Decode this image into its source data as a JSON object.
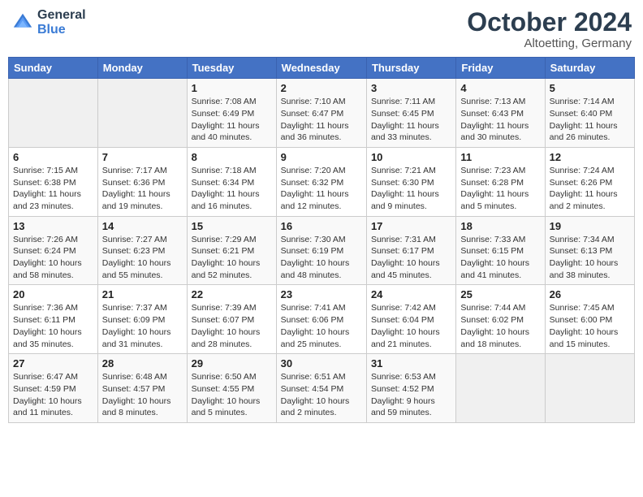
{
  "header": {
    "logo_line1": "General",
    "logo_line2": "Blue",
    "month": "October 2024",
    "location": "Altoetting, Germany"
  },
  "weekdays": [
    "Sunday",
    "Monday",
    "Tuesday",
    "Wednesday",
    "Thursday",
    "Friday",
    "Saturday"
  ],
  "weeks": [
    [
      {
        "day": "",
        "info": ""
      },
      {
        "day": "",
        "info": ""
      },
      {
        "day": "1",
        "info": "Sunrise: 7:08 AM\nSunset: 6:49 PM\nDaylight: 11 hours\nand 40 minutes."
      },
      {
        "day": "2",
        "info": "Sunrise: 7:10 AM\nSunset: 6:47 PM\nDaylight: 11 hours\nand 36 minutes."
      },
      {
        "day": "3",
        "info": "Sunrise: 7:11 AM\nSunset: 6:45 PM\nDaylight: 11 hours\nand 33 minutes."
      },
      {
        "day": "4",
        "info": "Sunrise: 7:13 AM\nSunset: 6:43 PM\nDaylight: 11 hours\nand 30 minutes."
      },
      {
        "day": "5",
        "info": "Sunrise: 7:14 AM\nSunset: 6:40 PM\nDaylight: 11 hours\nand 26 minutes."
      }
    ],
    [
      {
        "day": "6",
        "info": "Sunrise: 7:15 AM\nSunset: 6:38 PM\nDaylight: 11 hours\nand 23 minutes."
      },
      {
        "day": "7",
        "info": "Sunrise: 7:17 AM\nSunset: 6:36 PM\nDaylight: 11 hours\nand 19 minutes."
      },
      {
        "day": "8",
        "info": "Sunrise: 7:18 AM\nSunset: 6:34 PM\nDaylight: 11 hours\nand 16 minutes."
      },
      {
        "day": "9",
        "info": "Sunrise: 7:20 AM\nSunset: 6:32 PM\nDaylight: 11 hours\nand 12 minutes."
      },
      {
        "day": "10",
        "info": "Sunrise: 7:21 AM\nSunset: 6:30 PM\nDaylight: 11 hours\nand 9 minutes."
      },
      {
        "day": "11",
        "info": "Sunrise: 7:23 AM\nSunset: 6:28 PM\nDaylight: 11 hours\nand 5 minutes."
      },
      {
        "day": "12",
        "info": "Sunrise: 7:24 AM\nSunset: 6:26 PM\nDaylight: 11 hours\nand 2 minutes."
      }
    ],
    [
      {
        "day": "13",
        "info": "Sunrise: 7:26 AM\nSunset: 6:24 PM\nDaylight: 10 hours\nand 58 minutes."
      },
      {
        "day": "14",
        "info": "Sunrise: 7:27 AM\nSunset: 6:23 PM\nDaylight: 10 hours\nand 55 minutes."
      },
      {
        "day": "15",
        "info": "Sunrise: 7:29 AM\nSunset: 6:21 PM\nDaylight: 10 hours\nand 52 minutes."
      },
      {
        "day": "16",
        "info": "Sunrise: 7:30 AM\nSunset: 6:19 PM\nDaylight: 10 hours\nand 48 minutes."
      },
      {
        "day": "17",
        "info": "Sunrise: 7:31 AM\nSunset: 6:17 PM\nDaylight: 10 hours\nand 45 minutes."
      },
      {
        "day": "18",
        "info": "Sunrise: 7:33 AM\nSunset: 6:15 PM\nDaylight: 10 hours\nand 41 minutes."
      },
      {
        "day": "19",
        "info": "Sunrise: 7:34 AM\nSunset: 6:13 PM\nDaylight: 10 hours\nand 38 minutes."
      }
    ],
    [
      {
        "day": "20",
        "info": "Sunrise: 7:36 AM\nSunset: 6:11 PM\nDaylight: 10 hours\nand 35 minutes."
      },
      {
        "day": "21",
        "info": "Sunrise: 7:37 AM\nSunset: 6:09 PM\nDaylight: 10 hours\nand 31 minutes."
      },
      {
        "day": "22",
        "info": "Sunrise: 7:39 AM\nSunset: 6:07 PM\nDaylight: 10 hours\nand 28 minutes."
      },
      {
        "day": "23",
        "info": "Sunrise: 7:41 AM\nSunset: 6:06 PM\nDaylight: 10 hours\nand 25 minutes."
      },
      {
        "day": "24",
        "info": "Sunrise: 7:42 AM\nSunset: 6:04 PM\nDaylight: 10 hours\nand 21 minutes."
      },
      {
        "day": "25",
        "info": "Sunrise: 7:44 AM\nSunset: 6:02 PM\nDaylight: 10 hours\nand 18 minutes."
      },
      {
        "day": "26",
        "info": "Sunrise: 7:45 AM\nSunset: 6:00 PM\nDaylight: 10 hours\nand 15 minutes."
      }
    ],
    [
      {
        "day": "27",
        "info": "Sunrise: 6:47 AM\nSunset: 4:59 PM\nDaylight: 10 hours\nand 11 minutes."
      },
      {
        "day": "28",
        "info": "Sunrise: 6:48 AM\nSunset: 4:57 PM\nDaylight: 10 hours\nand 8 minutes."
      },
      {
        "day": "29",
        "info": "Sunrise: 6:50 AM\nSunset: 4:55 PM\nDaylight: 10 hours\nand 5 minutes."
      },
      {
        "day": "30",
        "info": "Sunrise: 6:51 AM\nSunset: 4:54 PM\nDaylight: 10 hours\nand 2 minutes."
      },
      {
        "day": "31",
        "info": "Sunrise: 6:53 AM\nSunset: 4:52 PM\nDaylight: 9 hours\nand 59 minutes."
      },
      {
        "day": "",
        "info": ""
      },
      {
        "day": "",
        "info": ""
      }
    ]
  ]
}
